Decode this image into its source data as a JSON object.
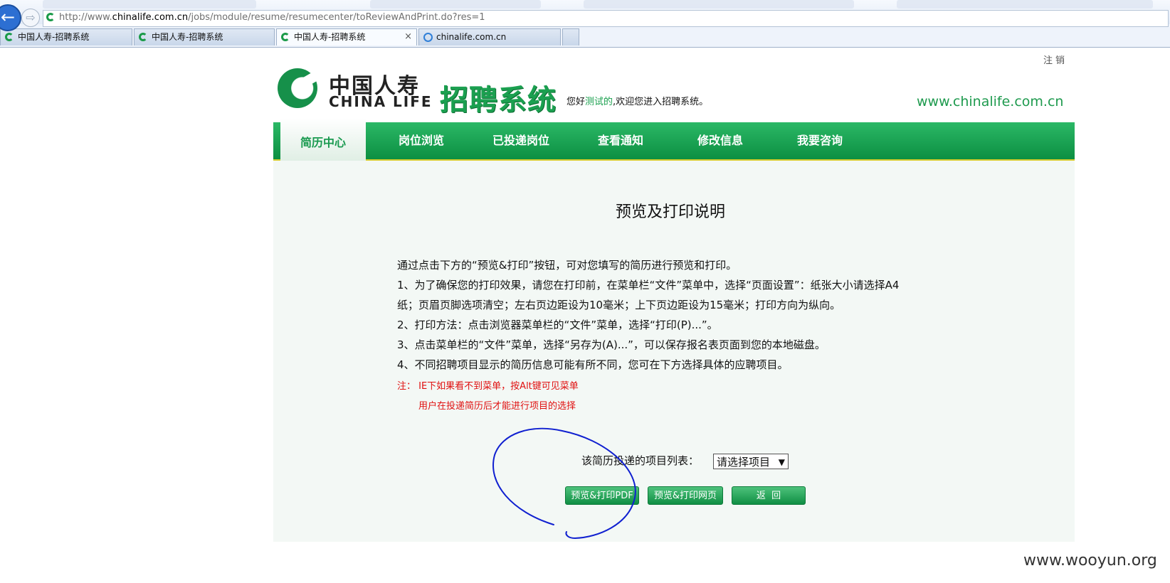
{
  "browser": {
    "url_prefix": "http://www.",
    "url_domain": "chinalife.com.cn",
    "url_path": "/jobs/module/resume/resumecenter/toReviewAndPrint.do?res=1",
    "tabs": [
      {
        "label": "中国人寿-招聘系统",
        "icon": "chinalife-icon"
      },
      {
        "label": "中国人寿-招聘系统",
        "icon": "chinalife-icon"
      },
      {
        "label": "中国人寿-招聘系统",
        "icon": "chinalife-icon",
        "close": "×"
      },
      {
        "label": "chinalife.com.cn",
        "icon": "ie-icon"
      }
    ]
  },
  "header": {
    "logout": "注销",
    "logo_cn": "中国人寿",
    "logo_en": "CHINA LIFE",
    "system_title": "招聘系统",
    "greeting_prefix": "您好",
    "username": "测试的",
    "greeting_suffix": ",欢迎您进入招聘系统。",
    "site_url": "www.chinalife.com.cn"
  },
  "nav": {
    "items": [
      "简历中心",
      "岗位浏览",
      "已投递岗位",
      "查看通知",
      "修改信息",
      "我要咨询"
    ],
    "active": "简历中心"
  },
  "main": {
    "title": "预览及打印说明",
    "paragraphs": [
      "通过点击下方的“预览&打印”按钮，可对您填写的简历进行预览和打印。",
      "1、为了确保您的打印效果，请您在打印前，在菜单栏“文件”菜单中，选择“页面设置”：纸张大小请选择A4",
      "纸；页眉页脚选项清空；左右页边距设为10毫米；上下页边距设为15毫米；打印方向为纵向。",
      "2、打印方法：点击浏览器菜单栏的“文件”菜单，选择“打印(P)...”。",
      "3、点击菜单栏的“文件”菜单，选择“另存为(A)...”，可以保存报名表页面到您的本地磁盘。",
      "4、不同招聘项目显示的简历信息可能有所不同，您可在下方选择具体的应聘项目。"
    ],
    "note_line1": "注：  IE下如果看不到菜单，按Alt键可见菜单",
    "note_line2": "用户在投递简历后才能进行项目的选择",
    "select_label": "该简历投递的项目列表：",
    "select_value": "请选择项目",
    "buttons": {
      "preview_pdf": "预览&打印PDF",
      "preview_web": "预览&打印网页",
      "back": "返  回"
    }
  },
  "watermark": "www.wooyun.org",
  "colors": {
    "brand_green": "#1aa04e",
    "nav_underline": "#d6cc2d",
    "note_red": "#e01010",
    "annotation_blue": "#1020d0"
  }
}
